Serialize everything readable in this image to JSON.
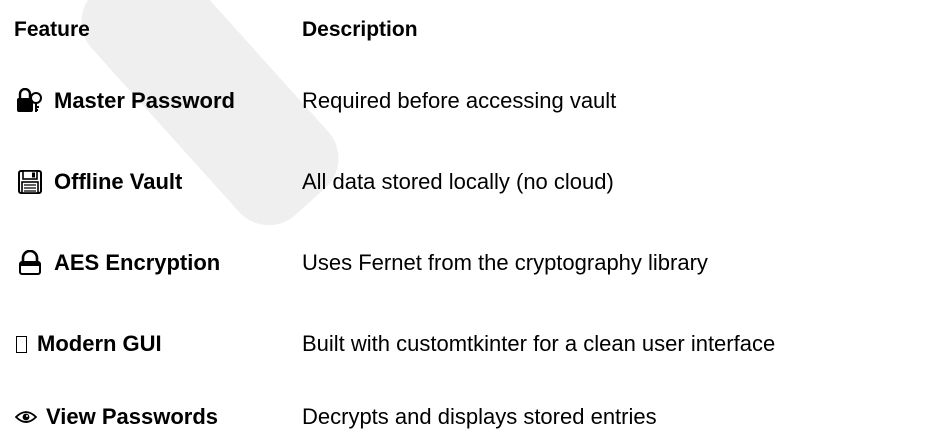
{
  "table": {
    "header": {
      "feature": "Feature",
      "description": "Description"
    },
    "rows": [
      {
        "icon": "key-lock-icon",
        "feature": "Master Password",
        "description": "Required before accessing vault"
      },
      {
        "icon": "floppy-disk-icon",
        "feature": "Offline Vault",
        "description": "All data stored locally (no cloud)"
      },
      {
        "icon": "lock-icon",
        "feature": "AES Encryption",
        "description": "Uses Fernet from the cryptography library"
      },
      {
        "icon": "missing-glyph-icon",
        "feature": "Modern GUI",
        "description": "Built with customtkinter for a clean user interface"
      },
      {
        "icon": "eye-icon",
        "feature": "View Passwords",
        "description": "Decrypts and displays stored entries"
      }
    ]
  }
}
